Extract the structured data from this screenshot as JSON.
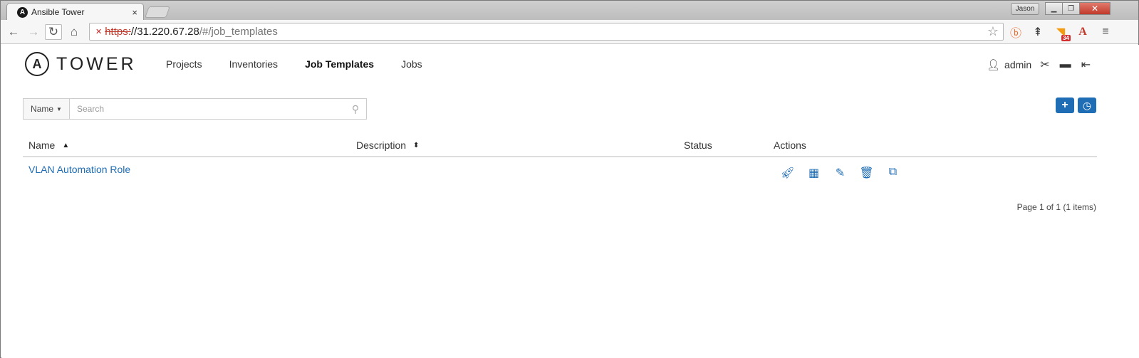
{
  "browser": {
    "tab_title": "Ansible Tower",
    "tab_close": "×",
    "profile_name": "Jason",
    "url_scheme": "https:",
    "url_host": "//31.220.67.28",
    "url_path": "/#/job_templates",
    "extension_badge": "34"
  },
  "app": {
    "logo_mark": "A",
    "logo_text": "TOWER",
    "nav": {
      "projects": "Projects",
      "inventories": "Inventories",
      "job_templates": "Job Templates",
      "jobs": "Jobs"
    },
    "user": "admin"
  },
  "search": {
    "field_label": "Name",
    "placeholder": "Search"
  },
  "table": {
    "headers": {
      "name": "Name",
      "description": "Description",
      "status": "Status",
      "actions": "Actions"
    },
    "rows": [
      {
        "name": "VLAN Automation Role",
        "description": "",
        "status": ""
      }
    ]
  },
  "pager": "Page 1 of 1 (1 items)",
  "colors": {
    "primary": "#1f6db4",
    "link": "#1f6db4"
  }
}
